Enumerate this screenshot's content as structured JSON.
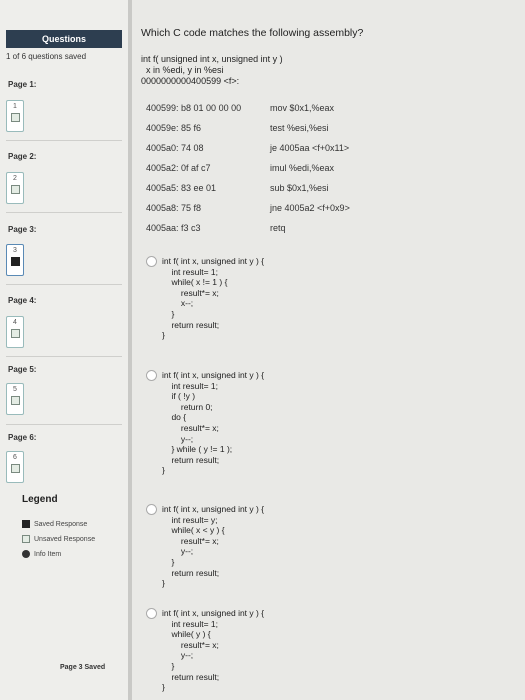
{
  "sidebar": {
    "header": "Questions",
    "saved_count": "1 of 6 questions saved",
    "pages": [
      {
        "label": "Page 1:",
        "num": "1"
      },
      {
        "label": "Page 2:",
        "num": "2"
      },
      {
        "label": "Page 3:",
        "num": "3"
      },
      {
        "label": "Page 4:",
        "num": "4"
      },
      {
        "label": "Page 5:",
        "num": "5"
      },
      {
        "label": "Page 6:",
        "num": "6"
      }
    ],
    "legend": {
      "title": "Legend",
      "saved": "Saved Response",
      "unsaved": "Unsaved Response",
      "info": "Info Item"
    },
    "page_saved": "Page 3 Saved"
  },
  "question": {
    "title": "Which C code matches the following assembly?",
    "prototype": [
      "int f( unsigned int x, unsigned int y )",
      "  x in %edi, y in %esi",
      "0000000000400599 <f>:"
    ],
    "assembly": [
      {
        "addr": "400599:  b8 01 00 00 00",
        "instr": "mov  $0x1,%eax"
      },
      {
        "addr": "40059e:  85 f6",
        "instr": "test %esi,%esi"
      },
      {
        "addr": "4005a0:  74 08",
        "instr": "je 4005aa <f+0x11>"
      },
      {
        "addr": "4005a2:  0f af c7",
        "instr": "imul %edi,%eax"
      },
      {
        "addr": "4005a5:  83 ee 01",
        "instr": "sub $0x1,%esi"
      },
      {
        "addr": "4005a8:  75 f8",
        "instr": "jne 4005a2 <f+0x9>"
      },
      {
        "addr": "4005aa:  f3 c3",
        "instr": "retq"
      }
    ],
    "options": [
      {
        "code": "int f( int x, unsigned int y ) {\n    int result= 1;\n    while( x != 1 ) {\n        result*= x;\n        x--;\n    }\n    return result;\n}"
      },
      {
        "code": "int f( int x, unsigned int y ) {\n    int result= 1;\n    if ( !y )\n        return 0;\n    do {\n        result*= x;\n        y--;\n    } while ( y != 1 );\n    return result;\n}"
      },
      {
        "code": "int f( int x, unsigned int y ) {\n    int result= y;\n    while( x < y ) {\n        result*= x;\n        y--;\n    }\n    return result;\n}"
      },
      {
        "code": "int f( int x, unsigned int y ) {\n    int result= 1;\n    while( y ) {\n        result*= x;\n        y--;\n    }\n    return result;\n}"
      }
    ]
  }
}
